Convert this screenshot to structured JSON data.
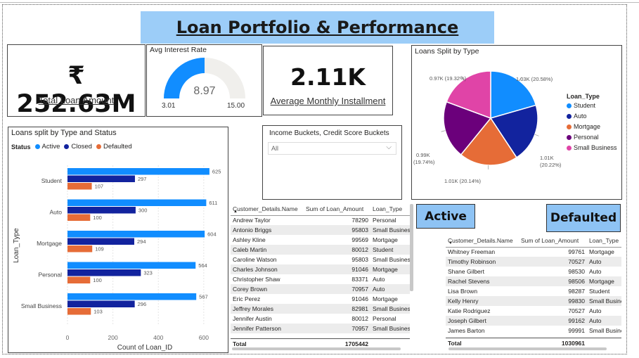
{
  "title": "Loan Portfolio & Performance",
  "kpis": {
    "total_loan": {
      "value": "₹ 252.63M",
      "label": "Total Loan Amount"
    },
    "avg_installment": {
      "value": "2.11K",
      "label": "Average Monthly Installment"
    }
  },
  "gauge": {
    "title": "Avg Interest Rate",
    "value": "8.97",
    "min": "3.01",
    "max": "15.00",
    "fraction": 0.5,
    "fill_color": "#118dff"
  },
  "filter": {
    "title": "Income Buckets, Credit Score Buckets",
    "selected": "All"
  },
  "buttons": {
    "active": "Active",
    "defaulted": "Defaulted"
  },
  "chart_data": [
    {
      "type": "bar",
      "title": "Loans split by Type and Status",
      "legend_title": "Status",
      "legend_position": "top-left",
      "xlabel": "Count of Loan_ID",
      "ylabel": "Loan_Type",
      "xlim": [
        0,
        650
      ],
      "xticks": [
        "0",
        "200",
        "400",
        "600"
      ],
      "orientation": "horizontal",
      "categories": [
        "Student",
        "Auto",
        "Mortgage",
        "Personal",
        "Small Business"
      ],
      "series": [
        {
          "name": "Active",
          "color": "#118dff",
          "values": [
            625,
            611,
            604,
            564,
            567
          ]
        },
        {
          "name": "Closed",
          "color": "#12239e",
          "values": [
            297,
            300,
            294,
            323,
            296
          ]
        },
        {
          "name": "Defaulted",
          "color": "#e66c37",
          "values": [
            107,
            100,
            109,
            100,
            103
          ]
        }
      ]
    },
    {
      "type": "pie",
      "title": "Loans Split by Type",
      "legend_title": "Loan_Type",
      "legend_position": "right",
      "slices": [
        {
          "name": "Student",
          "value": 1.03,
          "label": "1.03K (20.58%)",
          "color": "#118dff"
        },
        {
          "name": "Auto",
          "value": 1.01,
          "label": "1.01K (20.22%)",
          "color": "#12239e"
        },
        {
          "name": "Mortgage",
          "value": 1.01,
          "label": "1.01K (20.14%)",
          "color": "#e66c37"
        },
        {
          "name": "Personal",
          "value": 0.99,
          "label": "0.99K (19.74%)",
          "color": "#6b007b"
        },
        {
          "name": "Small Business",
          "value": 0.97,
          "label": "0.97K (19.32%)",
          "color": "#e044a7"
        }
      ]
    }
  ],
  "table_all": {
    "headers": [
      "Customer_Details.Name",
      "Sum of Loan_Amount",
      "Loan_Type"
    ],
    "rows": [
      [
        "Andrew Taylor",
        "78290",
        "Personal"
      ],
      [
        "Antonio Briggs",
        "95803",
        "Small Business"
      ],
      [
        "Ashley Kline",
        "99569",
        "Mortgage"
      ],
      [
        "Caleb Martin",
        "80012",
        "Student"
      ],
      [
        "Caroline Watson",
        "95803",
        "Small Business"
      ],
      [
        "Charles Johnson",
        "91046",
        "Mortgage"
      ],
      [
        "Christopher Shaw",
        "83371",
        "Auto"
      ],
      [
        "Corey Brown",
        "70957",
        "Auto"
      ],
      [
        "Eric Perez",
        "91046",
        "Mortgage"
      ],
      [
        "Jeffrey Morales",
        "82981",
        "Small Business"
      ],
      [
        "Jennifer Austin",
        "80012",
        "Personal"
      ],
      [
        "Jennifer Patterson",
        "70957",
        "Small Business"
      ]
    ],
    "total_label": "Total",
    "total_value": "1705442"
  },
  "table_defaulted": {
    "headers": [
      "Customer_Details.Name",
      "Sum of Loan_Amount",
      "Loan_Type"
    ],
    "rows": [
      [
        "Whitney Freeman",
        "99761",
        "Mortgage"
      ],
      [
        "Timothy Robinson",
        "70527",
        "Auto"
      ],
      [
        "Shane Gilbert",
        "98530",
        "Auto"
      ],
      [
        "Rachel Stevens",
        "98506",
        "Mortgage"
      ],
      [
        "Lisa Brown",
        "98287",
        "Student"
      ],
      [
        "Kelly Henry",
        "99830",
        "Small Business"
      ],
      [
        "Katie Rodriguez",
        "70527",
        "Auto"
      ],
      [
        "Joseph Gilbert",
        "99162",
        "Auto"
      ],
      [
        "James Barton",
        "99991",
        "Small Business"
      ]
    ],
    "total_label": "Total",
    "total_value": "1030961"
  }
}
